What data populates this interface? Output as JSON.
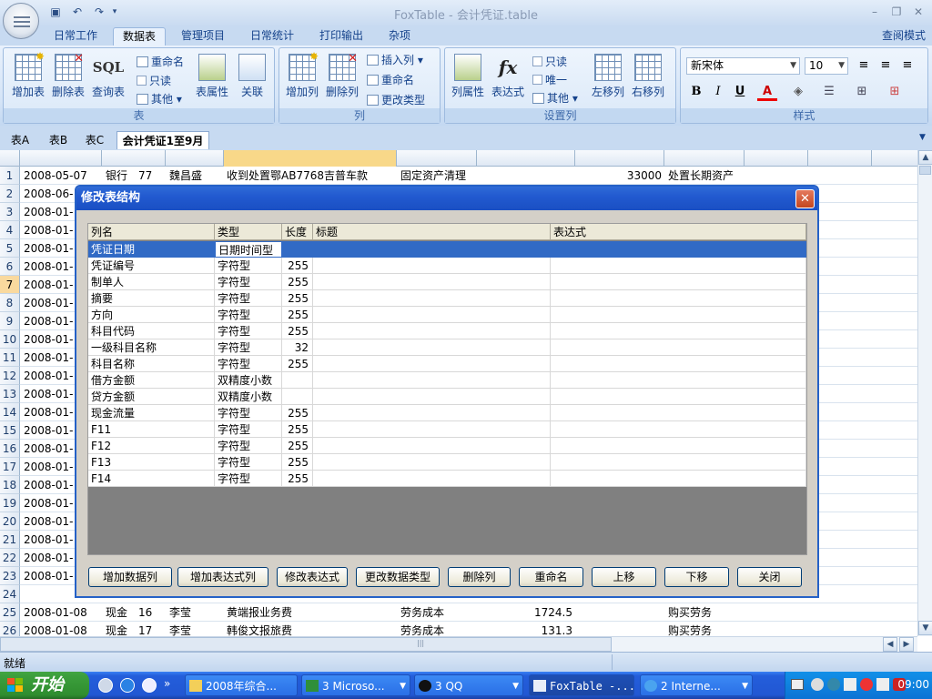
{
  "app": {
    "title": "FoxTable - 会计凭证.table",
    "help_mode": "查阅模式"
  },
  "ribbon_tabs": [
    "日常工作",
    "数据表",
    "管理项目",
    "日常统计",
    "打印输出",
    "杂项"
  ],
  "ribbon": {
    "table_group": {
      "label": "表",
      "add_table": "增加表",
      "delete_table": "删除表",
      "query_table": "查询表",
      "sql_icon_text": "SQL",
      "rename": "重命名",
      "readonly": "只读",
      "other": "其他",
      "table_props": "表属性",
      "relation": "关联"
    },
    "column_group": {
      "label": "列",
      "add_column": "增加列",
      "delete_column": "删除列",
      "insert_column": "插入列",
      "rename": "重命名",
      "change_type": "更改类型"
    },
    "settings_group": {
      "label": "设置列",
      "column_props": "列属性",
      "expression": "表达式",
      "fx_icon_text": "fx",
      "readonly": "只读",
      "unique": "唯一",
      "other": "其他",
      "move_left": "左移列",
      "move_right": "右移列"
    },
    "style_group": {
      "label": "样式",
      "font": "新宋体",
      "size": "10",
      "bold": "B",
      "italic": "I",
      "underline": "U",
      "font_color_glyph": "A"
    }
  },
  "sheet_tabs": [
    "表A",
    "表B",
    "表C",
    "会计凭证1至9月"
  ],
  "grid": {
    "row_numbers": [
      "1",
      "2",
      "3",
      "4",
      "5",
      "6",
      "7",
      "8",
      "9",
      "10",
      "11",
      "12",
      "13",
      "14",
      "15",
      "16",
      "17",
      "18",
      "19",
      "20",
      "21",
      "22",
      "23",
      "24",
      "25",
      "26"
    ],
    "current_row": "7",
    "row1": {
      "date": "2008-05-07",
      "type": "银行",
      "no": "77",
      "person": "魏昌盛",
      "summary": "收到处置鄂AB7768吉普车款",
      "account": "固定资产清理",
      "amount": "33000",
      "note": "处置长期资产"
    },
    "partial_dates": [
      "2008-06-",
      "2008-01-",
      "2008-01-",
      "2008-01-",
      "2008-01-",
      "2008-01-",
      "2008-01-",
      "2008-01-",
      "2008-01-",
      "2008-01-",
      "2008-01-",
      "2008-01-",
      "2008-01-",
      "2008-01-",
      "2008-01-",
      "2008-01-",
      "2008-01-",
      "2008-01-",
      "2008-01-",
      "2008-01-",
      "2008-01-",
      "2008-01-"
    ],
    "row25": {
      "date": "2008-01-08",
      "type": "现金",
      "no": "16",
      "person": "李莹",
      "summary": "黄端报业务费",
      "account": "劳务成本",
      "amount": "1724.5",
      "note": "购买劳务"
    },
    "row26": {
      "date": "2008-01-08",
      "type": "现金",
      "no": "17",
      "person": "李莹",
      "summary": "韩俊文报旅费",
      "account": "劳务成本",
      "amount": "131.3",
      "note": "购买劳务"
    }
  },
  "dialog": {
    "title": "修改表结构",
    "close_glyph": "✕",
    "headers": [
      "列名",
      "类型",
      "长度",
      "标题",
      "表达式"
    ],
    "rows": [
      {
        "name": "凭证日期",
        "type": "日期时间型",
        "length": ""
      },
      {
        "name": "凭证编号",
        "type": "字符型",
        "length": "255"
      },
      {
        "name": "制单人",
        "type": "字符型",
        "length": "255"
      },
      {
        "name": "摘要",
        "type": "字符型",
        "length": "255"
      },
      {
        "name": "方向",
        "type": "字符型",
        "length": "255"
      },
      {
        "name": "科目代码",
        "type": "字符型",
        "length": "255"
      },
      {
        "name": "一级科目名称",
        "type": "字符型",
        "length": "32"
      },
      {
        "name": "科目名称",
        "type": "字符型",
        "length": "255"
      },
      {
        "name": "借方金额",
        "type": "双精度小数",
        "length": ""
      },
      {
        "name": "贷方金额",
        "type": "双精度小数",
        "length": ""
      },
      {
        "name": "现金流量",
        "type": "字符型",
        "length": "255"
      },
      {
        "name": "F11",
        "type": "字符型",
        "length": "255"
      },
      {
        "name": "F12",
        "type": "字符型",
        "length": "255"
      },
      {
        "name": "F13",
        "type": "字符型",
        "length": "255"
      },
      {
        "name": "F14",
        "type": "字符型",
        "length": "255"
      }
    ],
    "buttons": [
      "增加数据列",
      "增加表达式列",
      "修改表达式",
      "更改数据类型",
      "删除列",
      "重命名",
      "上移",
      "下移",
      "关闭"
    ]
  },
  "status": {
    "text": "就绪"
  },
  "taskbar": {
    "start": "开始",
    "items": [
      "2008年综合...",
      "3 Microso...",
      "3 QQ",
      "FoxTable -...",
      "2 Interne..."
    ],
    "clock": "09:00"
  },
  "colors": {
    "selection": "#316ac5",
    "title_blue": "#225ad0",
    "taskbar": "#245edb",
    "start_green": "#3c9f3c"
  }
}
